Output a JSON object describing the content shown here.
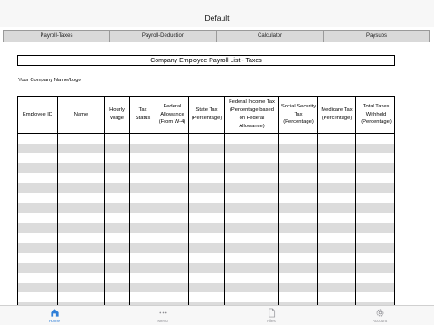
{
  "window": {
    "title": "Default"
  },
  "top_tabs": [
    "Payroll-Taxes",
    "Payroll-Deduction",
    "Calculator",
    "Paysubs"
  ],
  "sheet": {
    "title": "Company Employee Payroll List - Taxes",
    "company_label": "Your Company Name/Logo",
    "columns": [
      "Employee ID",
      "Name",
      "Hourly Wage",
      "Tax Status",
      "Federal Allowance (From W-4)",
      "State Tax (Percentage)",
      "Federal Income Tax (Percentage based on Federal Allowance)",
      "Social Security Tax (Percentage)",
      "Medicare Tax (Percentage)",
      "Total Taxes Withheld (Percentage)"
    ]
  },
  "bottom_tabs": [
    {
      "label": "Home",
      "icon": "home-icon",
      "active": true
    },
    {
      "label": "Menu",
      "icon": "more-dots-icon",
      "active": false
    },
    {
      "label": "Files",
      "icon": "file-icon",
      "active": false
    },
    {
      "label": "Account",
      "icon": "gear-icon",
      "active": false
    }
  ],
  "colors": {
    "accent": "#2f7fd8",
    "row_alt": "#dcdcdc",
    "tab_bg": "#d9d9d9"
  }
}
